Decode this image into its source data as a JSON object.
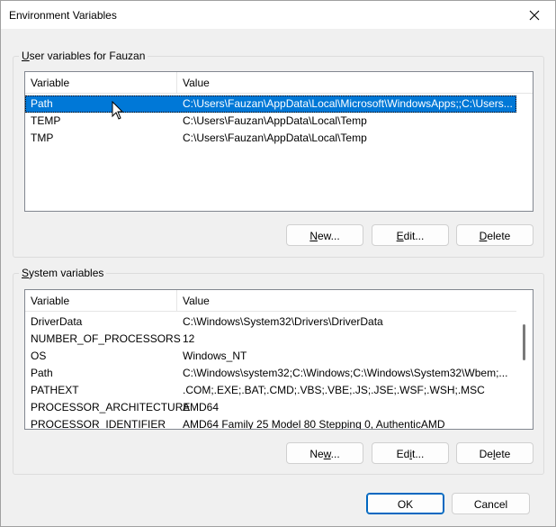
{
  "window": {
    "title": "Environment Variables",
    "close_icon": "close-icon"
  },
  "user_vars": {
    "legend_prefix": "U",
    "legend_rest": "ser variables for Fauzan",
    "columns": [
      "Variable",
      "Value"
    ],
    "rows": [
      {
        "name": "Path",
        "value": "C:\\Users\\Fauzan\\AppData\\Local\\Microsoft\\WindowsApps;;C:\\Users...",
        "selected": true
      },
      {
        "name": "TEMP",
        "value": "C:\\Users\\Fauzan\\AppData\\Local\\Temp"
      },
      {
        "name": "TMP",
        "value": "C:\\Users\\Fauzan\\AppData\\Local\\Temp"
      }
    ],
    "buttons": {
      "new_prefix": "N",
      "new_rest": "ew...",
      "edit_prefix": "E",
      "edit_rest": "dit...",
      "delete_prefix": "D",
      "delete_rest": "elete"
    }
  },
  "system_vars": {
    "legend_prefix": "S",
    "legend_rest": "ystem variables",
    "columns": [
      "Variable",
      "Value"
    ],
    "rows": [
      {
        "name": "DriverData",
        "value": "C:\\Windows\\System32\\Drivers\\DriverData"
      },
      {
        "name": "NUMBER_OF_PROCESSORS",
        "value": "12"
      },
      {
        "name": "OS",
        "value": "Windows_NT"
      },
      {
        "name": "Path",
        "value": "C:\\Windows\\system32;C:\\Windows;C:\\Windows\\System32\\Wbem;..."
      },
      {
        "name": "PATHEXT",
        "value": ".COM;.EXE;.BAT;.CMD;.VBS;.VBE;.JS;.JSE;.WSF;.WSH;.MSC"
      },
      {
        "name": "PROCESSOR_ARCHITECTURE",
        "value": "AMD64"
      },
      {
        "name": "PROCESSOR_IDENTIFIER",
        "value": "AMD64 Family 25 Model 80 Stepping 0, AuthenticAMD"
      }
    ],
    "buttons": {
      "new_a": "Ne",
      "new_u": "w",
      "new_b": "...",
      "edit_a": "Ed",
      "edit_u": "i",
      "edit_b": "t...",
      "delete_a": "De",
      "delete_u": "l",
      "delete_b": "ete"
    }
  },
  "footer": {
    "ok": "OK",
    "cancel": "Cancel"
  }
}
